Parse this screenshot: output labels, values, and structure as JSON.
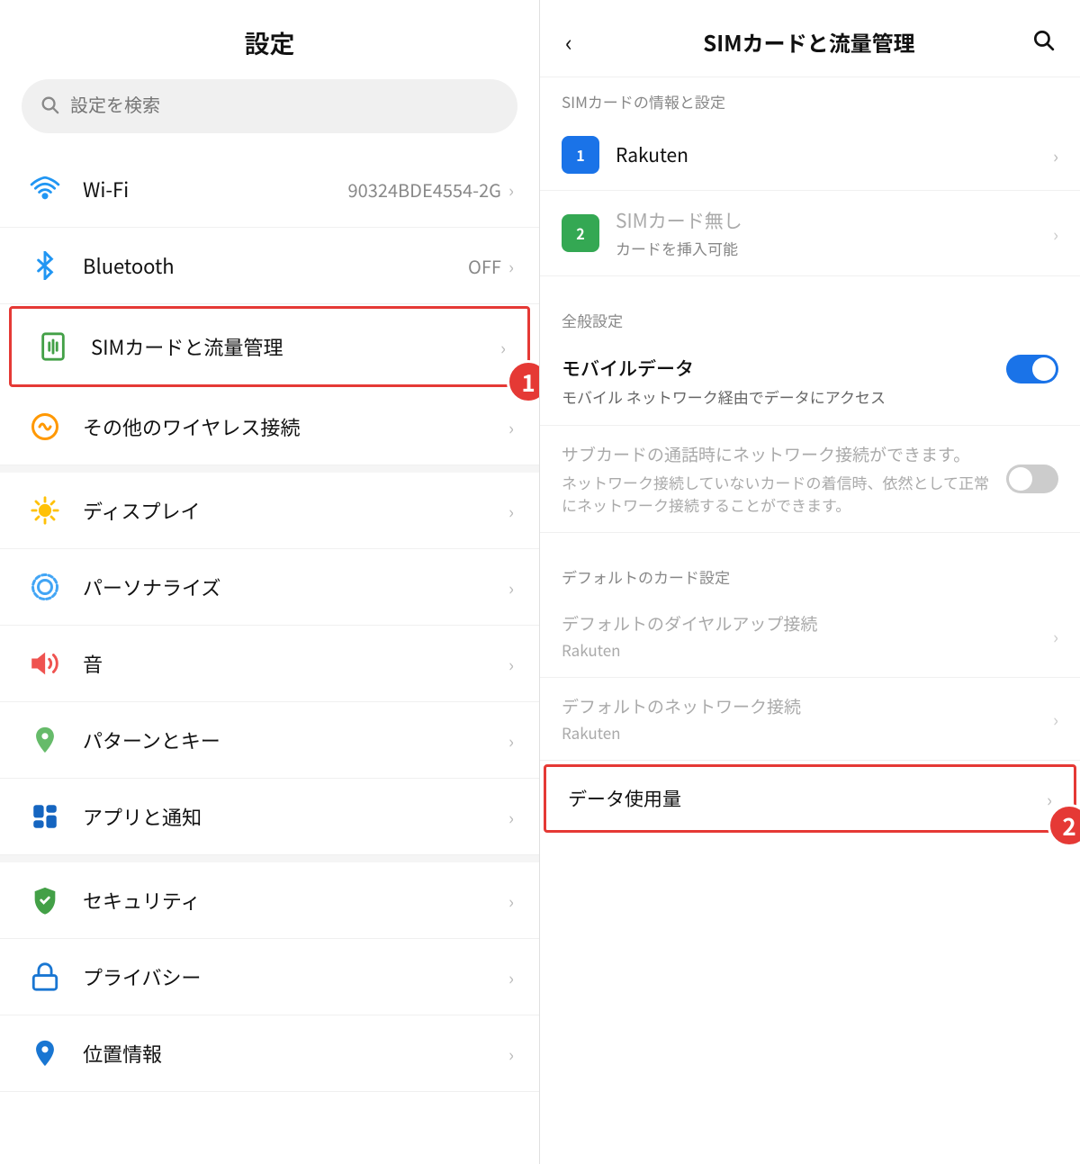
{
  "left": {
    "title": "設定",
    "search_placeholder": "設定を検索",
    "items": [
      {
        "id": "wifi",
        "label": "Wi-Fi",
        "value": "90324BDE4554-2G",
        "icon": "wifi",
        "highlighted": false
      },
      {
        "id": "bluetooth",
        "label": "Bluetooth",
        "value": "OFF",
        "icon": "bluetooth",
        "highlighted": false
      },
      {
        "id": "sim",
        "label": "SIMカードと流量管理",
        "value": "",
        "icon": "sim",
        "highlighted": true
      },
      {
        "id": "wireless",
        "label": "その他のワイヤレス接続",
        "value": "",
        "icon": "wireless",
        "highlighted": false
      },
      {
        "id": "display",
        "label": "ディスプレイ",
        "value": "",
        "icon": "display",
        "highlighted": false
      },
      {
        "id": "personalize",
        "label": "パーソナライズ",
        "value": "",
        "icon": "personalize",
        "highlighted": false
      },
      {
        "id": "sound",
        "label": "音",
        "value": "",
        "icon": "sound",
        "highlighted": false
      },
      {
        "id": "pattern",
        "label": "パターンとキー",
        "value": "",
        "icon": "pattern",
        "highlighted": false
      },
      {
        "id": "app",
        "label": "アプリと通知",
        "value": "",
        "icon": "app",
        "highlighted": false
      },
      {
        "id": "security",
        "label": "セキュリティ",
        "value": "",
        "icon": "security",
        "highlighted": false
      },
      {
        "id": "privacy",
        "label": "プライバシー",
        "value": "",
        "icon": "privacy",
        "highlighted": false
      },
      {
        "id": "location",
        "label": "位置情報",
        "value": "",
        "icon": "location",
        "highlighted": false
      }
    ],
    "badge_1_label": "1"
  },
  "right": {
    "title": "SIMカードと流量管理",
    "section_top_label": "SIMカードの情報と設定",
    "sim1_name": "Rakuten",
    "sim2_name": "SIMカード無し",
    "sim2_sub": "カードを挿入可能",
    "general_settings_label": "全般設定",
    "mobile_data_label": "モバイルデータ",
    "mobile_data_desc": "モバイル ネットワーク経由でデータにアクセス",
    "mobile_data_on": true,
    "subcard_label": "サブカードの通話時にネットワーク接続ができます。",
    "subcard_desc": "ネットワーク接続していないカードの着信時、依然として正常にネットワーク接続することができます。",
    "subcard_on": false,
    "default_card_settings_label": "デフォルトのカード設定",
    "default_dialup_label": "デフォルトのダイヤルアップ接続",
    "default_dialup_value": "Rakuten",
    "default_network_label": "デフォルトのネットワーク接続",
    "default_network_value": "Rakuten",
    "data_usage_label": "データ使用量",
    "badge_2_label": "2"
  }
}
